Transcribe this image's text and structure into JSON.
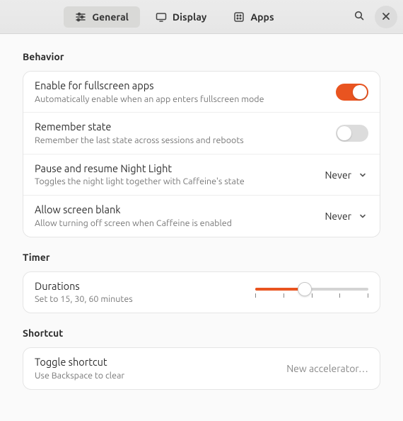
{
  "colors": {
    "accent": "#e95420"
  },
  "header": {
    "tabs": {
      "general": "General",
      "display": "Display",
      "apps": "Apps"
    }
  },
  "sections": {
    "behavior": {
      "title": "Behavior",
      "fullscreen": {
        "title": "Enable for fullscreen apps",
        "sub": "Automatically enable when an app enters fullscreen mode",
        "value": true
      },
      "remember": {
        "title": "Remember state",
        "sub": "Remember the last state across sessions and reboots",
        "value": false
      },
      "nightlight": {
        "title": "Pause and resume Night Light",
        "sub": "Toggles the night light together with Caffeine's state",
        "value": "Never"
      },
      "screenblank": {
        "title": "Allow screen blank",
        "sub": "Allow turning off screen when Caffeine is enabled",
        "value": "Never"
      }
    },
    "timer": {
      "title": "Timer",
      "durations": {
        "title": "Durations",
        "sub": "Set to 15, 30, 60 minutes"
      }
    },
    "shortcut": {
      "title": "Shortcut",
      "toggle": {
        "title": "Toggle shortcut",
        "sub": "Use Backspace to clear",
        "value": "New accelerator…"
      }
    }
  }
}
